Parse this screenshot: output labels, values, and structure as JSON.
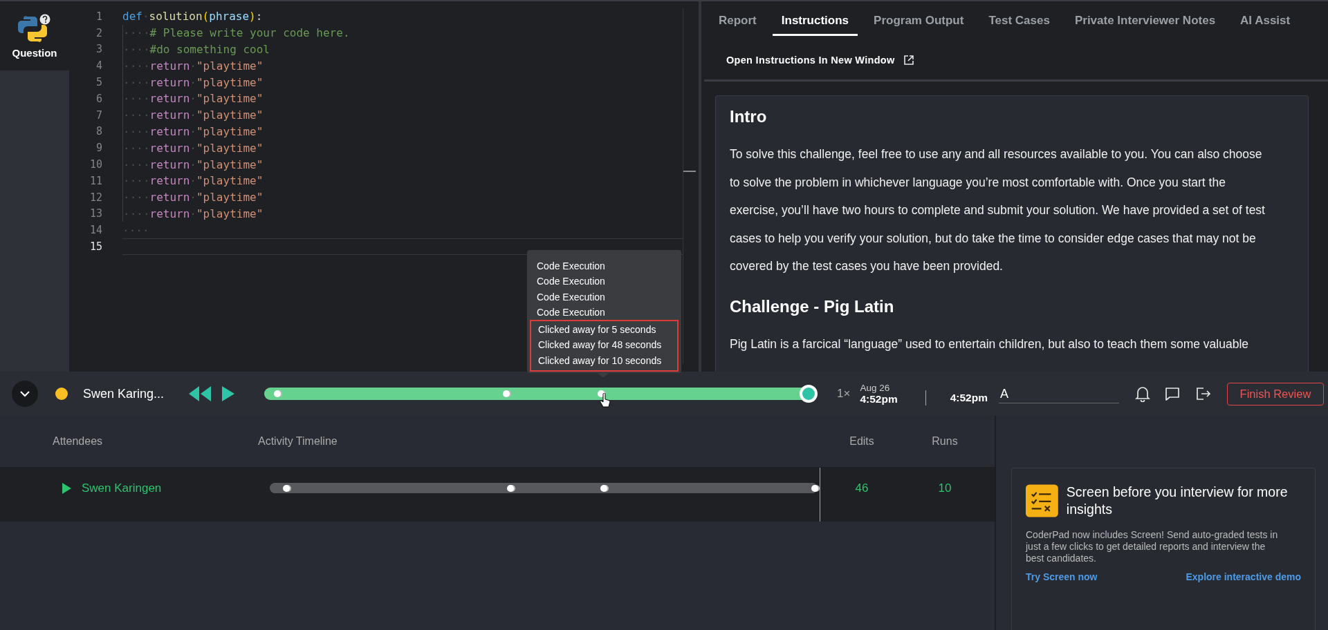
{
  "sidebar": {
    "label": "Question"
  },
  "editor": {
    "lines": [
      {
        "number": "1",
        "current": false,
        "tokens": [
          {
            "kind": "keyword",
            "text": "def"
          },
          {
            "kind": "space",
            "text": "·"
          },
          {
            "kind": "function",
            "text": "solution"
          },
          {
            "kind": "paren",
            "text": "("
          },
          {
            "kind": "param",
            "text": "phrase"
          },
          {
            "kind": "paren",
            "text": ")"
          },
          {
            "kind": "plain",
            "text": ":"
          }
        ]
      },
      {
        "number": "2",
        "current": false,
        "tokens": [
          {
            "kind": "space",
            "text": "····"
          },
          {
            "kind": "comment",
            "text": "# Please write your code here."
          }
        ]
      },
      {
        "number": "3",
        "current": false,
        "tokens": [
          {
            "kind": "space",
            "text": "····"
          },
          {
            "kind": "comment",
            "text": "#do something cool"
          }
        ]
      },
      {
        "number": "4",
        "current": false,
        "tokens": [
          {
            "kind": "space",
            "text": "····"
          },
          {
            "kind": "keyword2",
            "text": "return"
          },
          {
            "kind": "space",
            "text": "·"
          },
          {
            "kind": "string",
            "text": "\"playtime\""
          }
        ]
      },
      {
        "number": "5",
        "current": false,
        "tokens": [
          {
            "kind": "space",
            "text": "····"
          },
          {
            "kind": "keyword2",
            "text": "return"
          },
          {
            "kind": "space",
            "text": "·"
          },
          {
            "kind": "string",
            "text": "\"playtime\""
          }
        ]
      },
      {
        "number": "6",
        "current": false,
        "tokens": [
          {
            "kind": "space",
            "text": "····"
          },
          {
            "kind": "keyword2",
            "text": "return"
          },
          {
            "kind": "space",
            "text": "·"
          },
          {
            "kind": "string",
            "text": "\"playtime\""
          }
        ]
      },
      {
        "number": "7",
        "current": false,
        "tokens": [
          {
            "kind": "space",
            "text": "····"
          },
          {
            "kind": "keyword2",
            "text": "return"
          },
          {
            "kind": "space",
            "text": "·"
          },
          {
            "kind": "string",
            "text": "\"playtime\""
          }
        ]
      },
      {
        "number": "8",
        "current": false,
        "tokens": [
          {
            "kind": "space",
            "text": "····"
          },
          {
            "kind": "keyword2",
            "text": "return"
          },
          {
            "kind": "space",
            "text": "·"
          },
          {
            "kind": "string",
            "text": "\"playtime\""
          }
        ]
      },
      {
        "number": "9",
        "current": false,
        "tokens": [
          {
            "kind": "space",
            "text": "····"
          },
          {
            "kind": "keyword2",
            "text": "return"
          },
          {
            "kind": "space",
            "text": "·"
          },
          {
            "kind": "string",
            "text": "\"playtime\""
          }
        ]
      },
      {
        "number": "10",
        "current": false,
        "tokens": [
          {
            "kind": "space",
            "text": "····"
          },
          {
            "kind": "keyword2",
            "text": "return"
          },
          {
            "kind": "space",
            "text": "·"
          },
          {
            "kind": "string",
            "text": "\"playtime\""
          }
        ]
      },
      {
        "number": "11",
        "current": false,
        "tokens": [
          {
            "kind": "space",
            "text": "····"
          },
          {
            "kind": "keyword2",
            "text": "return"
          },
          {
            "kind": "space",
            "text": "·"
          },
          {
            "kind": "string",
            "text": "\"playtime\""
          }
        ]
      },
      {
        "number": "12",
        "current": false,
        "tokens": [
          {
            "kind": "space",
            "text": "····"
          },
          {
            "kind": "keyword2",
            "text": "return"
          },
          {
            "kind": "space",
            "text": "·"
          },
          {
            "kind": "string",
            "text": "\"playtime\""
          }
        ]
      },
      {
        "number": "13",
        "current": false,
        "tokens": [
          {
            "kind": "space",
            "text": "····"
          },
          {
            "kind": "keyword2",
            "text": "return"
          },
          {
            "kind": "space",
            "text": "·"
          },
          {
            "kind": "string",
            "text": "\"playtime\""
          }
        ]
      },
      {
        "number": "14",
        "current": false,
        "tokens": [
          {
            "kind": "space",
            "text": "····"
          }
        ]
      },
      {
        "number": "15",
        "current": true
      }
    ]
  },
  "tabs": [
    {
      "label": "Report",
      "selected": false
    },
    {
      "label": "Instructions",
      "selected": true
    },
    {
      "label": "Program Output",
      "selected": false
    },
    {
      "label": "Test Cases",
      "selected": false
    },
    {
      "label": "Private Interviewer Notes",
      "selected": false
    },
    {
      "label": "AI Assist",
      "selected": false
    }
  ],
  "open_link": "Open Instructions In New Window",
  "instructions": [
    {
      "heading": "Intro",
      "paragraph": "To solve this challenge, feel free to use any and all resources available to you. You can also choose to solve the problem in whichever language you’re most comfortable with. Once you start the exercise, you’ll have two hours to complete and submit your solution. We have provided a set of test cases to help you verify your solution, but do take the time to consider edge cases that may not be covered by the test cases you have been provided."
    },
    {
      "heading": "Challenge - Pig Latin",
      "paragraph": "Pig Latin is a farcical “language” used to entertain children, but also to teach them some valuable"
    }
  ],
  "tooltip": [
    {
      "text": "Code Execution",
      "flagged": false
    },
    {
      "text": "Code Execution",
      "flagged": false
    },
    {
      "text": "Code Execution",
      "flagged": false
    },
    {
      "text": "Code Execution",
      "flagged": false
    },
    {
      "text": "Clicked away for 5 seconds",
      "flagged": true
    },
    {
      "text": "Clicked away for 48 seconds",
      "flagged": true
    },
    {
      "text": "Clicked away for 10 seconds",
      "flagged": true
    }
  ],
  "player": {
    "name": "Swen Karing...",
    "color": "#fbbf24",
    "level": 1,
    "speed": "1×",
    "date": "Aug 26",
    "start_time": "4:52pm",
    "end_time": "4:52pm",
    "field_value": "A",
    "finish": "Finish Review"
  },
  "table": {
    "columns": [
      "Attendees",
      "Activity Timeline",
      "Edits",
      "Runs"
    ],
    "rows": [
      {
        "name": "Swen Karingen",
        "edits": "46",
        "runs": "10"
      }
    ]
  },
  "promo": {
    "title": "Screen before you interview for more insights",
    "body": "CoderPad now includes Screen! Send auto-graded tests in just a few clicks to get detailed reports and interview the best candidates.",
    "links": [
      "Try Screen now",
      "Explore interactive demo"
    ]
  }
}
